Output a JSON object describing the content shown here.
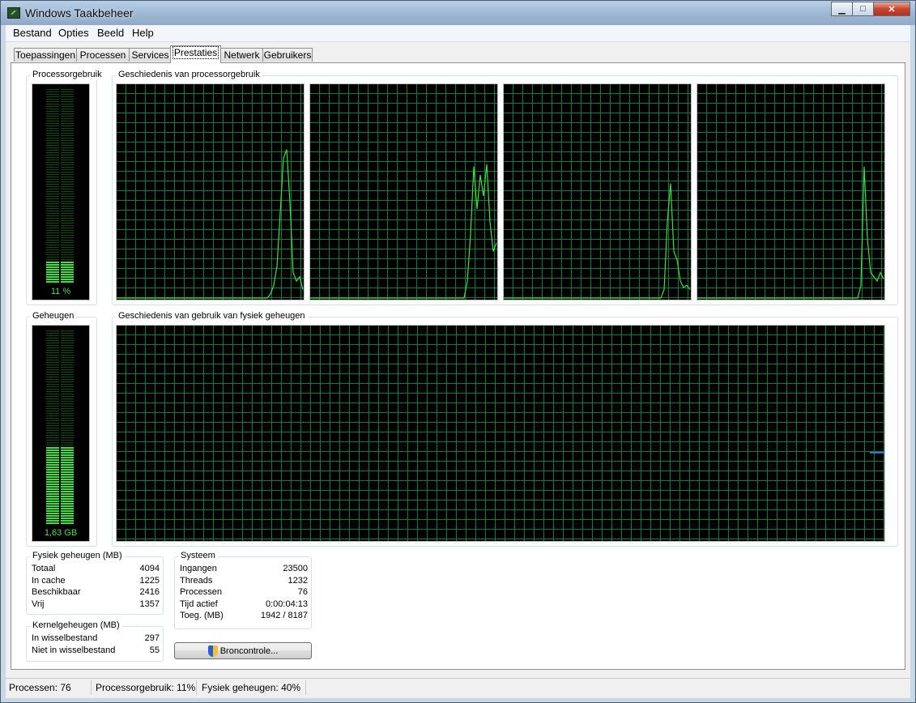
{
  "window": {
    "title": "Windows Taakbeheer"
  },
  "menu": [
    "Bestand",
    "Opties",
    "Beeld",
    "Help"
  ],
  "tabs": [
    "Toepassingen",
    "Processen",
    "Services",
    "Prestaties",
    "Netwerk",
    "Gebruikers"
  ],
  "active_tab": "Prestaties",
  "cpu": {
    "label": "Processorgebruik",
    "value_text": "11 %",
    "value": 0.11,
    "history_label": "Geschiedenis van processorgebruik",
    "history": [
      [
        0,
        0,
        0,
        0,
        0,
        0,
        0,
        0,
        0,
        0,
        0,
        0,
        0,
        0,
        0,
        0,
        0,
        0,
        0,
        0,
        0,
        0,
        0,
        0,
        0,
        0,
        0,
        0,
        0,
        0,
        0,
        0,
        0,
        0,
        0,
        0,
        0,
        0,
        0,
        0,
        0,
        0,
        0,
        0,
        0,
        0,
        2,
        6,
        15,
        40,
        66,
        70,
        45,
        12,
        8,
        10,
        4
      ],
      [
        0,
        0,
        0,
        0,
        0,
        0,
        0,
        0,
        0,
        0,
        0,
        0,
        0,
        0,
        0,
        0,
        0,
        0,
        0,
        0,
        0,
        0,
        0,
        0,
        0,
        0,
        0,
        0,
        0,
        0,
        0,
        0,
        0,
        0,
        0,
        0,
        0,
        0,
        0,
        0,
        0,
        0,
        0,
        0,
        0,
        0,
        0,
        0,
        0,
        8,
        30,
        62,
        42,
        58,
        48,
        63,
        36,
        22,
        26
      ],
      [
        0,
        0,
        0,
        0,
        0,
        0,
        0,
        0,
        0,
        0,
        0,
        0,
        0,
        0,
        0,
        0,
        0,
        0,
        0,
        0,
        0,
        0,
        0,
        0,
        0,
        0,
        0,
        0,
        0,
        0,
        0,
        0,
        0,
        0,
        0,
        0,
        0,
        0,
        0,
        0,
        0,
        0,
        0,
        0,
        0,
        0,
        0,
        0,
        0,
        0,
        0,
        0,
        4,
        36,
        54,
        22,
        18,
        8,
        5,
        6,
        4
      ],
      [
        0,
        0,
        0,
        0,
        0,
        0,
        0,
        0,
        0,
        0,
        0,
        0,
        0,
        0,
        0,
        0,
        0,
        0,
        0,
        0,
        0,
        0,
        0,
        0,
        0,
        0,
        0,
        0,
        0,
        0,
        0,
        0,
        0,
        0,
        0,
        0,
        0,
        0,
        0,
        0,
        0,
        0,
        0,
        0,
        0,
        0,
        0,
        0,
        0,
        0,
        0,
        0,
        0,
        6,
        62,
        28,
        12,
        10,
        8,
        12,
        9
      ]
    ]
  },
  "memory": {
    "label": "Geheugen",
    "value_text": "1,63 GB",
    "value": 0.4,
    "history_label": "Geschiedenis van gebruik van fysiek geheugen",
    "history": [
      0.41,
      0.41,
      0.41,
      0.41
    ]
  },
  "physical": {
    "label": "Fysiek geheugen (MB)",
    "rows": [
      {
        "k": "Totaal",
        "v": "4094"
      },
      {
        "k": "In cache",
        "v": "1225"
      },
      {
        "k": "Beschikbaar",
        "v": "2416"
      },
      {
        "k": "Vrij",
        "v": "1357"
      }
    ]
  },
  "kernel": {
    "label": "Kernelgeheugen (MB)",
    "rows": [
      {
        "k": "In wisselbestand",
        "v": "297"
      },
      {
        "k": "Niet in wisselbestand",
        "v": "55"
      }
    ]
  },
  "system": {
    "label": "Systeem",
    "rows": [
      {
        "k": "Ingangen",
        "v": "23500"
      },
      {
        "k": "Threads",
        "v": "1232"
      },
      {
        "k": "Processen",
        "v": "76"
      },
      {
        "k": "Tijd actief",
        "v": "0:00:04:13"
      },
      {
        "k": "Toeg. (MB)",
        "v": "1942 / 8187"
      }
    ]
  },
  "resource_button": "Broncontrole...",
  "status": {
    "processes": "Processen: 76",
    "cpu": "Processorgebruik: 11%",
    "memory": "Fysiek geheugen: 40%"
  },
  "colors": {
    "graph_bg": "#000000",
    "grid": "#0a7e3a",
    "cpu_line": "#3ce23c",
    "mem_line": "#2a7fd8"
  }
}
